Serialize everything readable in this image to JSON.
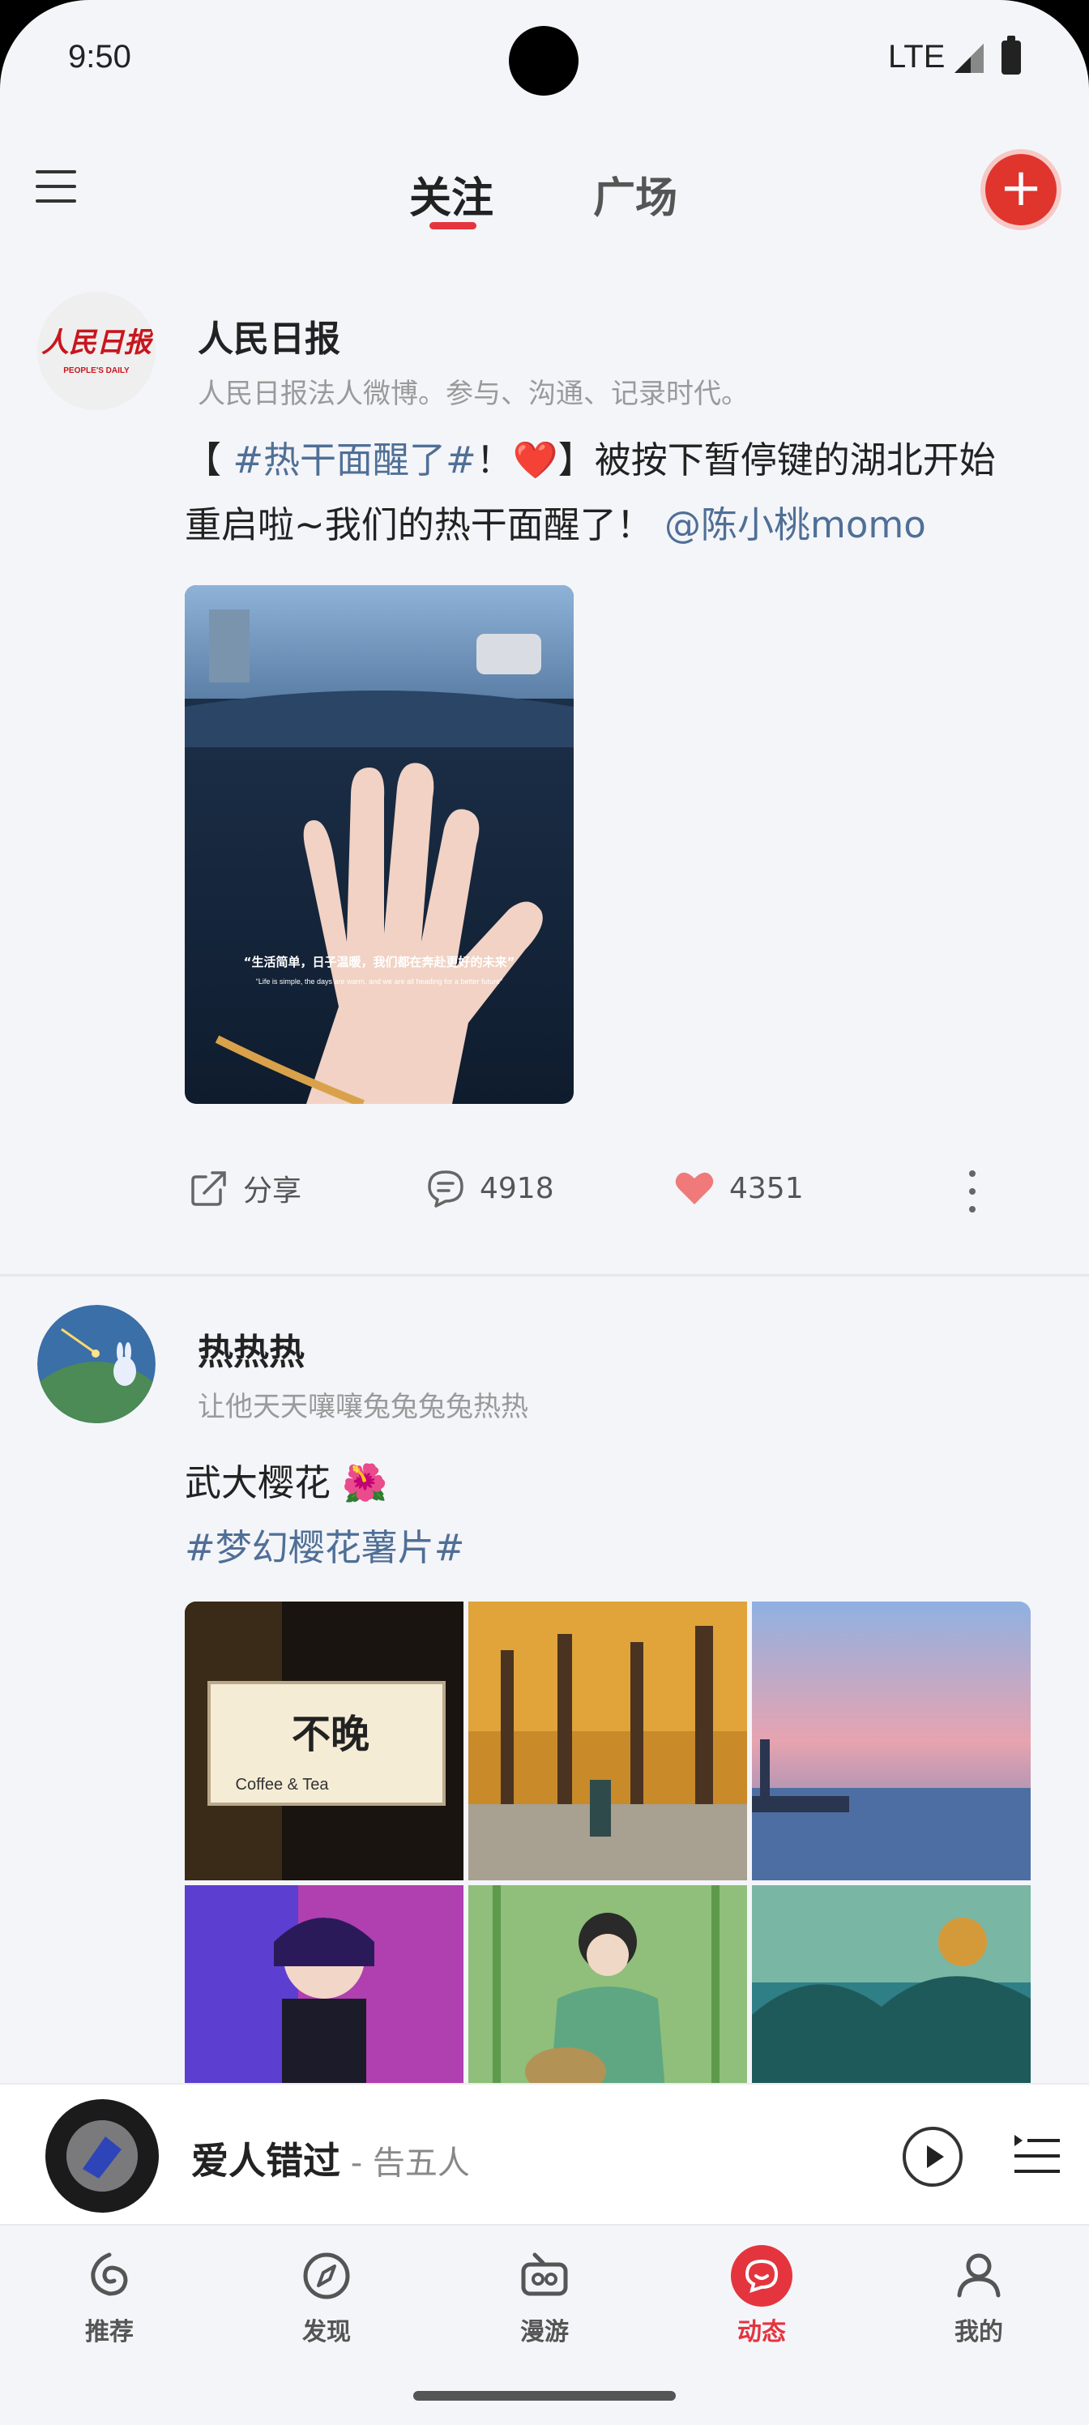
{
  "status_bar": {
    "time": "9:50",
    "network": "LTE"
  },
  "header": {
    "tabs": [
      {
        "label": "关注",
        "active": true
      },
      {
        "label": "广场",
        "active": false
      }
    ]
  },
  "posts": [
    {
      "author": "人民日报",
      "subtitle": "人民日报法人微博。参与、沟通、记录时代。",
      "avatar_logo_text": "人民日报",
      "avatar_logo_sub": "PEOPLE'S DAILY",
      "content": {
        "prefix": "【 ",
        "tag": "#热干面醒了#",
        "after_tag": "！",
        "emoji": "❤️",
        "body": "】被按下暂停键的湖北开始重启啦~我们的热干面醒了！",
        "mention": "@陈小桃momo"
      },
      "image_caption_cn": "“生活简单，日子温暖，我们都在奔赴更好的未来”",
      "image_caption_en": "“Life is simple, the days are warm, and we are all heading for a better future”",
      "actions": {
        "share": "分享",
        "comments": "4918",
        "likes": "4351"
      }
    },
    {
      "author": "热热热",
      "subtitle": "让他天天嚷嚷兔兔兔兔热热",
      "content": {
        "line1": "武大樱花",
        "emoji": "🌺",
        "tag": "#梦幻樱花薯片#"
      },
      "grid_sign_text": "不晚",
      "grid_sign_sub": "Coffee & Tea"
    }
  ],
  "player": {
    "song": "爱人错过",
    "artist_sep": " - ",
    "artist": "告五人"
  },
  "nav": [
    {
      "label": "推荐",
      "icon": "recommend-icon",
      "active": false
    },
    {
      "label": "发现",
      "icon": "compass-icon",
      "active": false
    },
    {
      "label": "漫游",
      "icon": "radio-icon",
      "active": false
    },
    {
      "label": "动态",
      "icon": "moments-icon",
      "active": true
    },
    {
      "label": "我的",
      "icon": "profile-icon",
      "active": false
    }
  ],
  "colors": {
    "accent": "#e4353e",
    "link": "#4f6f96"
  }
}
